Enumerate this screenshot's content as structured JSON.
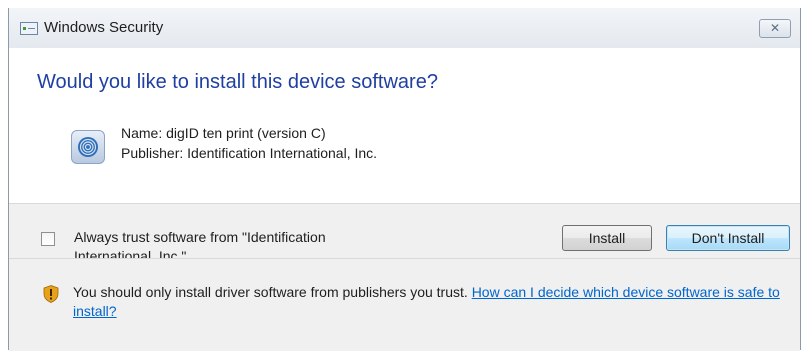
{
  "window": {
    "title": "Windows Security",
    "close_label": "✕"
  },
  "dialog": {
    "heading": "Would you like to install this device software?",
    "device_name": "Name: digID ten print (version C)",
    "publisher": "Publisher: Identification International, Inc."
  },
  "trust": {
    "checked": false,
    "label": "Always trust software from \"Identification International, Inc.\"."
  },
  "buttons": {
    "install": "Install",
    "dont_install": "Don't Install"
  },
  "warning": {
    "text": "You should only install driver software from publishers you trust.",
    "link": "How can I decide which device software is safe to install?"
  },
  "colors": {
    "heading": "#1f3fa3",
    "link": "#0066cc",
    "panel_bg": "#f0f0f0"
  }
}
